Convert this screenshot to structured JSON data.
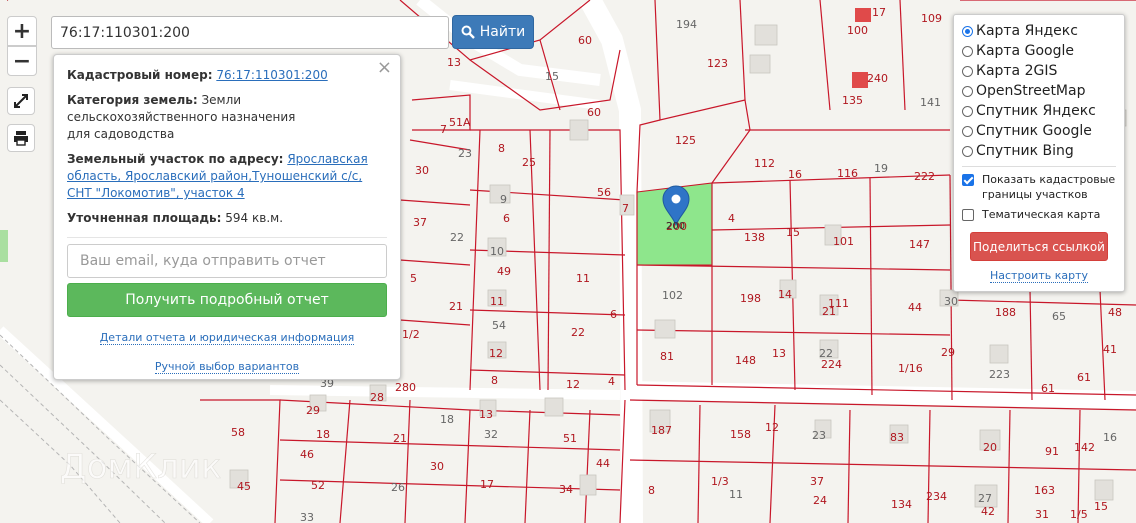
{
  "search": {
    "value": "76:17:110301:200",
    "button_label": "Найти"
  },
  "controls": {
    "zoom_in": "+",
    "zoom_out": "−"
  },
  "info": {
    "cadastral_label": "Кадастровый номер:",
    "cadastral_value": "76:17:110301:200",
    "category_label": "Категория земель:",
    "category_value_1": "Земли сельскохозяйственного назначения",
    "category_value_2": "для садоводства",
    "address_label": "Земельный участок по адресу:",
    "address_value": "Ярославская область, Ярославский район,Туношенский с/с, СНТ \"Локомотив\", участок 4",
    "area_label": "Уточненная площадь:",
    "area_value": "594 кв.м.",
    "email_placeholder": "Ваш email, куда отправить отчет",
    "report_button": "Получить подробный отчет",
    "details_link": "Детали отчета и юридическая информация",
    "manual_link": "Ручной выбор вариантов",
    "close": "×"
  },
  "layers": {
    "options": [
      {
        "label": "Карта Яндекс",
        "selected": true
      },
      {
        "label": "Карта Google",
        "selected": false
      },
      {
        "label": "Карта 2GIS",
        "selected": false
      },
      {
        "label": "OpenStreetMap",
        "selected": false
      },
      {
        "label": "Спутник Яндекс",
        "selected": false
      },
      {
        "label": "Спутник Google",
        "selected": false
      },
      {
        "label": "Спутник Bing",
        "selected": false
      }
    ],
    "show_borders": "Показать кадастровые границы участков",
    "show_borders_checked": true,
    "thematic": "Тематическая карта",
    "thematic_checked": false,
    "share_button": "Поделиться ссылкой",
    "settings_link": "Настроить карту"
  },
  "map": {
    "selected_parcel": "200",
    "watermark": "ДомКлик",
    "labels": [
      "194",
      "100",
      "17",
      "109",
      "13",
      "15",
      "123",
      "60",
      "240",
      "135",
      "141",
      "60",
      "51А",
      "7",
      "125",
      "23",
      "8",
      "25",
      "112",
      "30",
      "9",
      "56",
      "7",
      "16",
      "116",
      "19",
      "222",
      "37",
      "6",
      "4",
      "22",
      "138",
      "15",
      "101",
      "147",
      "10",
      "200",
      "49",
      "5",
      "11",
      "102",
      "198",
      "14",
      "111",
      "44",
      "30",
      "188",
      "48",
      "21",
      "11",
      "54",
      "1/2",
      "22",
      "6",
      "21",
      "65",
      "12",
      "81",
      "148",
      "13",
      "22",
      "224",
      "1/16",
      "29",
      "41",
      "39",
      "280",
      "8",
      "12",
      "4",
      "223",
      "61",
      "61",
      "29",
      "28",
      "18",
      "13",
      "58",
      "18",
      "21",
      "32",
      "51",
      "187",
      "158",
      "12",
      "23",
      "83",
      "20",
      "91",
      "142",
      "16",
      "46",
      "30",
      "17",
      "52",
      "26",
      "34",
      "44",
      "8",
      "1/3",
      "11",
      "37",
      "24",
      "134",
      "234",
      "27",
      "42",
      "163",
      "15",
      "45",
      "33",
      "31",
      "1/5",
      "1/5"
    ],
    "colors": {
      "border": "#c8172a",
      "selected_fill": "#8ee68c",
      "road": "#ffffff",
      "pin": "#2f74c7"
    }
  }
}
